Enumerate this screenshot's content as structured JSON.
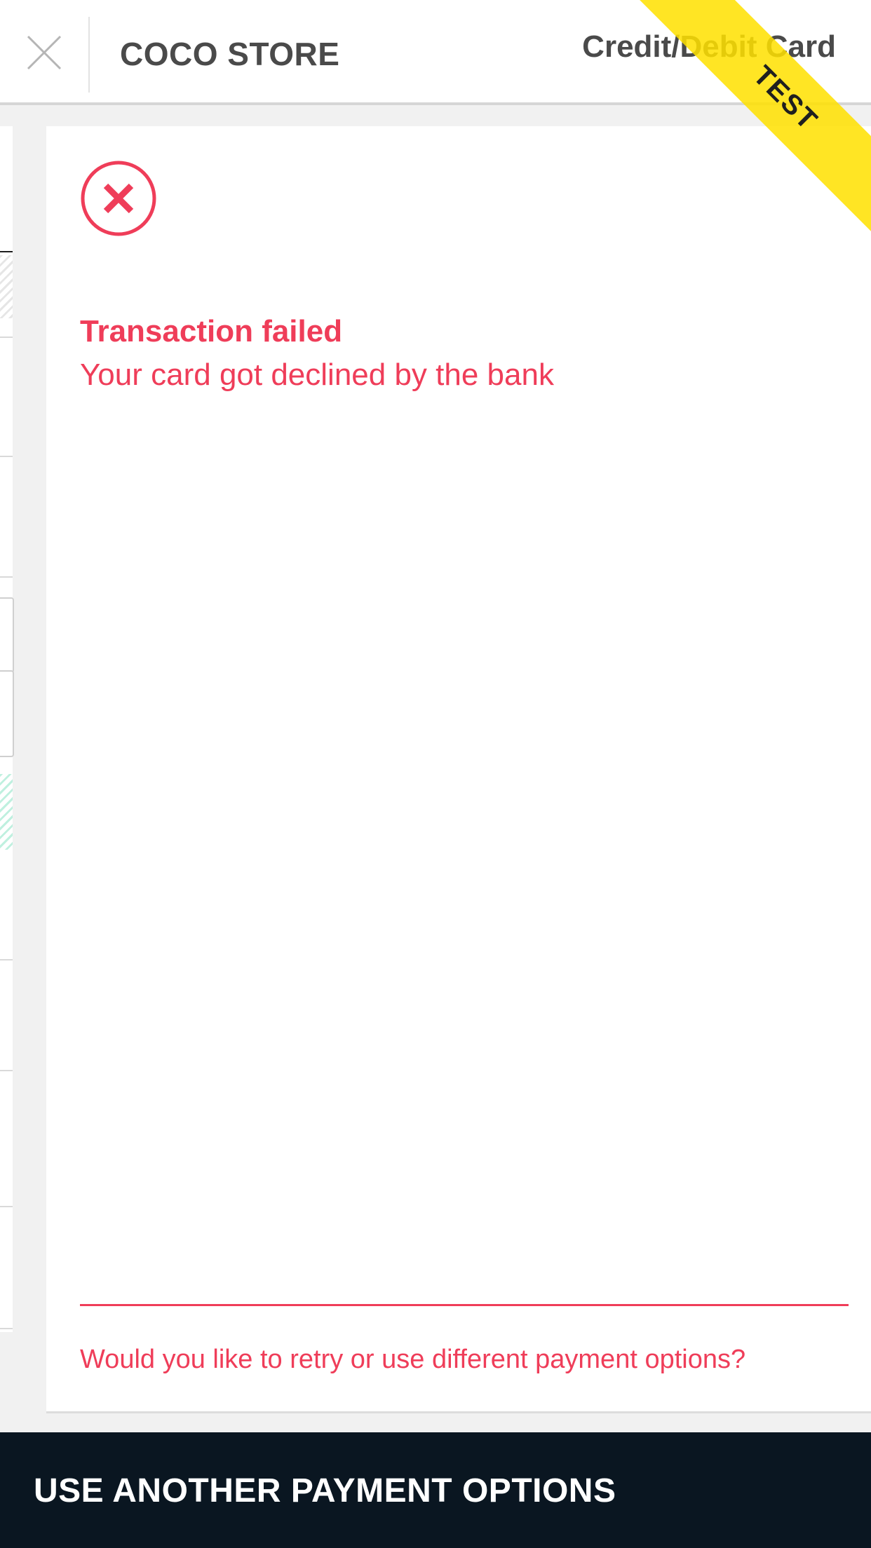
{
  "header": {
    "store_name": "COCO STORE",
    "payment_method": "Credit/Debit Card",
    "close_icon": "close-icon"
  },
  "ribbon": {
    "label": "TEST",
    "color": "#ffe100"
  },
  "result": {
    "status_icon": "error-circle-x-icon",
    "title": "Transaction failed",
    "message": "Your card got declined by the bank",
    "retry_prompt": "Would you like to retry or use different payment options?",
    "accent_color": "#ef3d59"
  },
  "footer": {
    "action_label": "USE ANOTHER PAYMENT OPTIONS",
    "background_color": "#0a1621"
  }
}
